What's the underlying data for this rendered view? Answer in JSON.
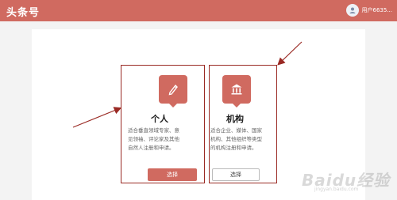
{
  "header": {
    "brand": "头条号",
    "username": "用户6635..."
  },
  "cards": {
    "personal": {
      "title": "个人",
      "desc_line1": "适合垂直领域专家、意",
      "desc_line2": "见领袖、评论家及其他",
      "desc_line3": "自然人注册和申请。",
      "button": "选择"
    },
    "organization": {
      "title": "机构",
      "desc_line1": "适合企业、媒体、国家",
      "desc_line2": "机构、其他组织等类型",
      "desc_line3": "的机构注册和申请。",
      "button": "选择"
    }
  },
  "watermark": {
    "text": "Baidu经验",
    "sub": "jingyan.baidu.com"
  },
  "colors": {
    "brand": "#d06a60",
    "annotation": "#9a2a24"
  }
}
